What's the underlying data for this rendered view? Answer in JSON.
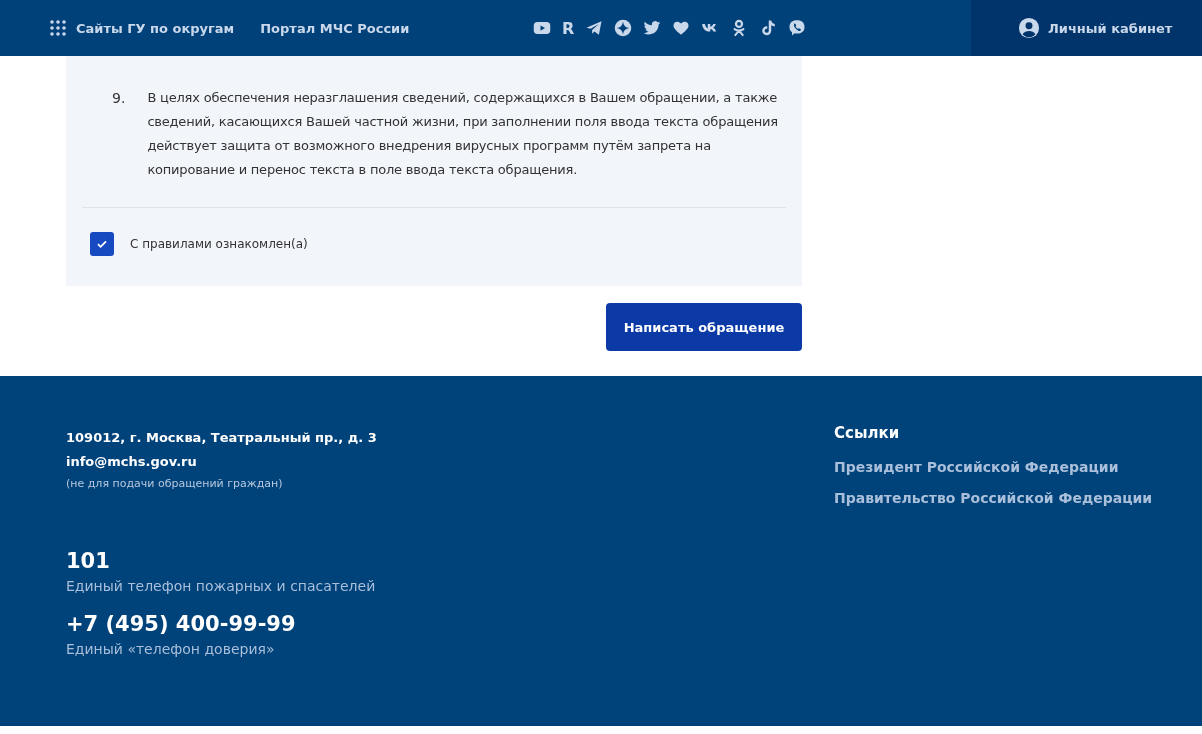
{
  "header": {
    "nav": [
      {
        "label": "Сайты ГУ по округам",
        "kind": "grid"
      },
      {
        "label": "Портал МЧС России",
        "kind": "plain"
      }
    ],
    "social": [
      {
        "kind": "play"
      },
      {
        "kind": "letter",
        "label": "R"
      },
      {
        "kind": "plane"
      },
      {
        "kind": "star"
      },
      {
        "kind": "bird"
      },
      {
        "kind": "heart"
      },
      {
        "kind": "vk"
      },
      {
        "kind": "ok"
      },
      {
        "kind": "note"
      },
      {
        "kind": "bubble"
      }
    ],
    "account": {
      "label": "Личный кабинет"
    }
  },
  "rules": {
    "items": [
      {
        "number": "9.",
        "text": "В целях обеспечения неразглашения сведений, содержащихся в Вашем обращении, а также сведений, касающихся Вашей частной жизни, при заполнении поля ввода текста обращения действует защита от возможного внедрения вирусных программ путём запрета на копирование и перенос текста в поле ввода текста обращения."
      }
    ],
    "agree": {
      "label": "С правилами ознакомлен(а)",
      "checked": true
    }
  },
  "submit": {
    "label": "Написать обращение"
  },
  "footer": {
    "address": "109012, г. Москва, Театральный пр., д. 3",
    "email": "info@mchs.gov.ru",
    "email_note": "(не для подачи обращений граждан)",
    "phones": [
      {
        "number": "101",
        "caption": "Единый телефон пожарных и спасателей"
      },
      {
        "number": "+7 (495) 400-99-99",
        "caption": "Единый «телефон доверия»"
      }
    ],
    "links_title": "Ссылки",
    "links": [
      "Президент Российской Федерации",
      "Правительство Российской Федерации"
    ]
  }
}
